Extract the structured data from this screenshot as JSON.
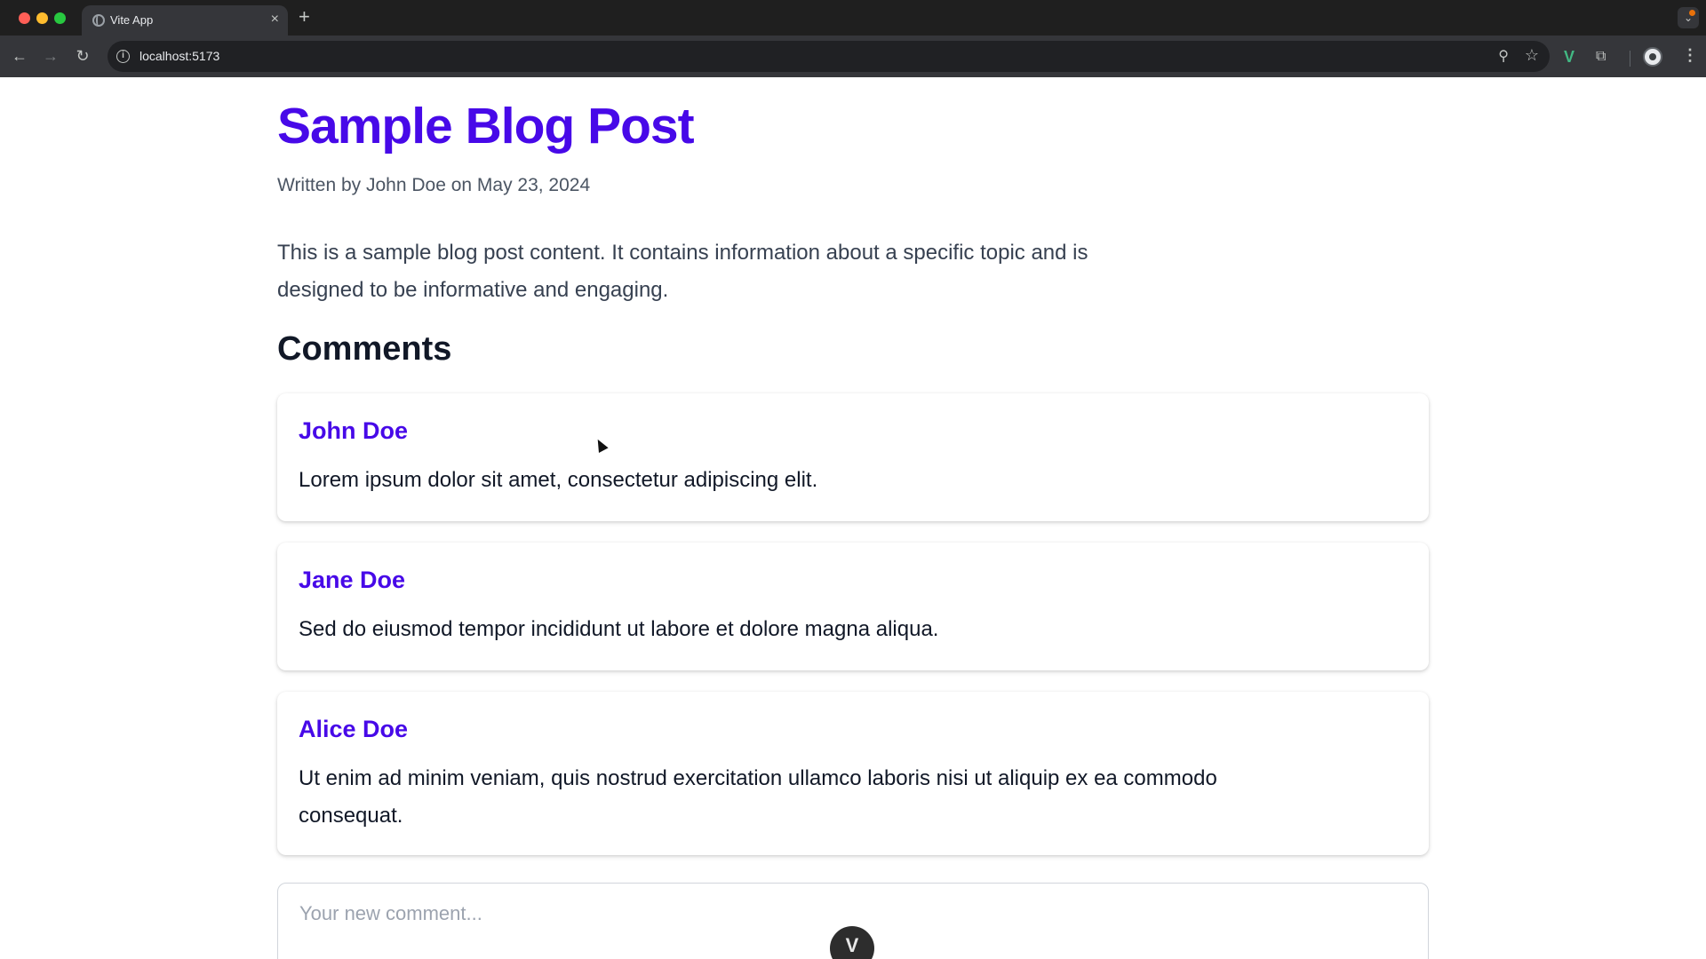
{
  "browser": {
    "tab_title": "Vite App",
    "tab_close": "×",
    "new_tab": "+",
    "tabs_menu": "⌄",
    "url": "localhost:5173",
    "icons": {
      "back": "arrow-left-icon",
      "forward": "arrow-right-icon",
      "reload": "reload-icon",
      "site_info": "info-icon",
      "zoom": "zoom-icon",
      "bookmark": "star-icon",
      "vue_extension": "vue-devtools-icon",
      "extensions": "puzzle-icon",
      "profile": "avatar",
      "menu": "kebab-icon"
    }
  },
  "post": {
    "title": "Sample Blog Post",
    "meta": "Written by John Doe on May 23, 2024",
    "body": "This is a sample blog post content. It contains information about a specific topic and is designed to be informative and engaging."
  },
  "comments": {
    "heading": "Comments",
    "items": [
      {
        "author": "John Doe",
        "text": "Lorem ipsum dolor sit amet, consectetur adipiscing elit."
      },
      {
        "author": "Jane Doe",
        "text": "Sed do eiusmod tempor incididunt ut labore et dolore magna aliqua."
      },
      {
        "author": "Alice Doe",
        "text": "Ut enim ad minim veniam, quis nostrud exercitation ullamco laboris nisi ut aliquip ex ea commodo consequat."
      }
    ],
    "input_placeholder": "Your new comment..."
  },
  "devtools_button": "V",
  "colors": {
    "accent": "#4709e8",
    "heading": "#111827",
    "text": "#374151"
  }
}
